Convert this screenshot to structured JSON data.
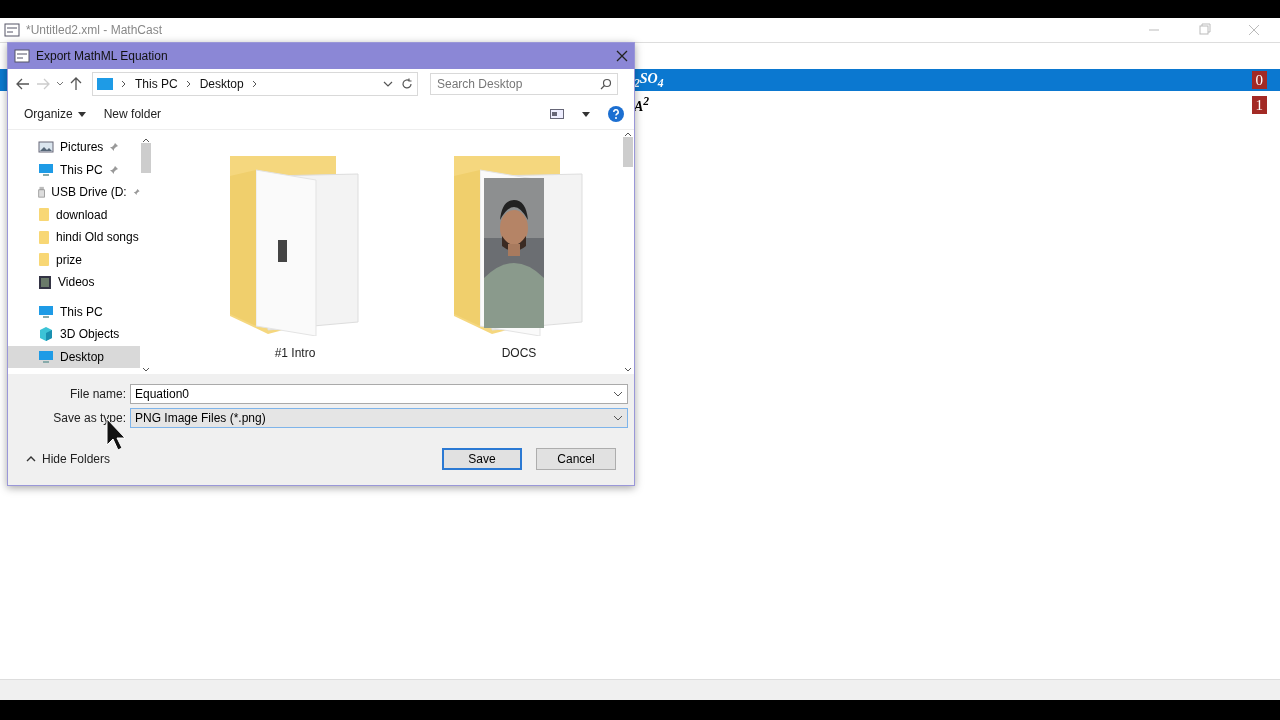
{
  "window": {
    "title": "*Untitled2.xml - MathCast"
  },
  "equations": [
    {
      "equation": "$_{2}$SO$_{4}$",
      "index": "0",
      "selected": true
    },
    {
      "equation": "A$^{2}$",
      "index": "1",
      "selected": false
    }
  ],
  "dialog": {
    "title": "Export MathML Equation",
    "breadcrumb": [
      "This PC",
      "Desktop"
    ],
    "search": {
      "placeholder": "Search Desktop"
    },
    "toolbar": {
      "organize": "Organize",
      "new_folder": "New folder"
    },
    "nav_pane": {
      "items": [
        {
          "label": "Pictures",
          "kind": "pictures",
          "pinned": true,
          "selected": false
        },
        {
          "label": "This PC",
          "kind": "pc",
          "pinned": true,
          "selected": false
        },
        {
          "label": "USB Drive (D:",
          "kind": "drive",
          "pinned": true,
          "selected": false
        },
        {
          "label": "download",
          "kind": "folder",
          "pinned": false,
          "selected": false
        },
        {
          "label": "hindi Old songs",
          "kind": "folder",
          "pinned": false,
          "selected": false
        },
        {
          "label": "prize",
          "kind": "folder",
          "pinned": false,
          "selected": false
        },
        {
          "label": "Videos",
          "kind": "videos",
          "pinned": false,
          "selected": false
        },
        {
          "label": "This PC",
          "kind": "pc",
          "pinned": false,
          "selected": false,
          "children": [
            {
              "label": "3D Objects",
              "kind": "objects",
              "selected": false
            },
            {
              "label": "Desktop",
              "kind": "desktop",
              "selected": true
            }
          ]
        }
      ]
    },
    "files": [
      {
        "name": "#1 Intro",
        "kind": "document"
      },
      {
        "name": "DOCS"
      }
    ],
    "file_name": {
      "label": "File name:",
      "value": "Equation0"
    },
    "save_type": {
      "label": "Save as type:",
      "value": "PNG Image Files (*.png)"
    },
    "hide_folders": "Hide Folders",
    "buttons": [
      {
        "label": "Save",
        "default": true
      },
      {
        "label": "Cancel",
        "default": false
      }
    ]
  }
}
